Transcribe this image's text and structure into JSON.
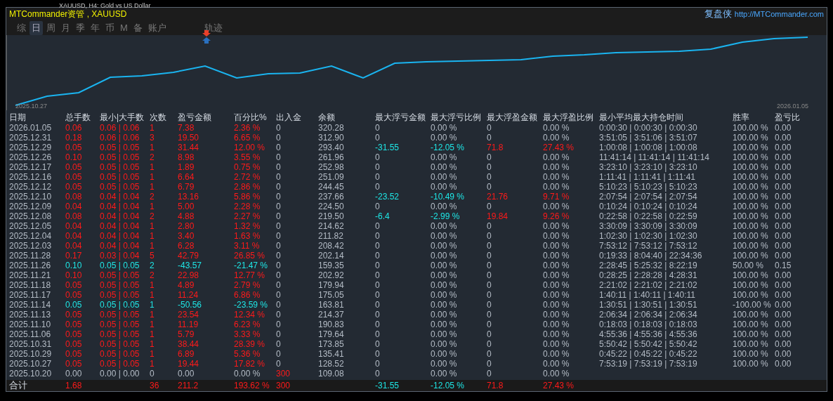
{
  "background_chart": {
    "title": "XAUUSD, H4:  Gold vs US Dollar"
  },
  "window": {
    "title": "MTCommander资管 , XAUUSD",
    "brand": "复盘侠",
    "link": "http://MTCommander.com"
  },
  "tabs": [
    {
      "label": "综",
      "selected": false
    },
    {
      "label": "日",
      "selected": true
    },
    {
      "label": "周",
      "selected": false
    },
    {
      "label": "月",
      "selected": false
    },
    {
      "label": "季",
      "selected": false
    },
    {
      "label": "年",
      "selected": false
    },
    {
      "label": "币",
      "selected": false
    },
    {
      "label": "M",
      "selected": false
    },
    {
      "label": "备",
      "selected": false
    },
    {
      "label": "账户",
      "selected": false
    },
    {
      "label": "轨迹",
      "selected": false
    }
  ],
  "equity_chart": {
    "start_label": "2025.10.27",
    "end_label": "2026.01.05"
  },
  "table": {
    "columns": [
      "日期",
      "总手数",
      "最小|大手数",
      "次数",
      "盈亏金额",
      "百分比%",
      "出入金",
      "余额",
      "最大浮亏金额",
      "最大浮亏比例",
      "最大浮盈金额",
      "最大浮盈比例",
      "最小平均最大持仓时间",
      "胜率",
      "盈亏比"
    ],
    "rows": [
      {
        "kind": "win",
        "floating": false,
        "deposit_flow": false,
        "cells": [
          "2026.01.05",
          "0.06",
          "0.06 | 0.06",
          "1",
          "7.38",
          "2.36 %",
          "0",
          "320.28",
          "0",
          "0.00 %",
          "0",
          "0.00 %",
          "0:00:30 | 0:00:30 | 0:00:30",
          "100.00 %",
          "0.00"
        ]
      },
      {
        "kind": "win",
        "floating": false,
        "deposit_flow": false,
        "cells": [
          "2025.12.31",
          "0.18",
          "0.06 | 0.06",
          "3",
          "19.50",
          "6.65 %",
          "0",
          "312.90",
          "0",
          "0.00 %",
          "0",
          "0.00 %",
          "3:51:05 | 3:51:06 | 3:51:07",
          "100.00 %",
          "0.00"
        ]
      },
      {
        "kind": "win",
        "floating": true,
        "deposit_flow": false,
        "cells": [
          "2025.12.29",
          "0.05",
          "0.05 | 0.05",
          "1",
          "31.44",
          "12.00 %",
          "0",
          "293.40",
          "-31.55",
          "-12.05 %",
          "71.8",
          "27.43 %",
          "1:00:08 | 1:00:08 | 1:00:08",
          "100.00 %",
          "0.00"
        ]
      },
      {
        "kind": "win",
        "floating": false,
        "deposit_flow": false,
        "cells": [
          "2025.12.26",
          "0.10",
          "0.05 | 0.05",
          "2",
          "8.98",
          "3.55 %",
          "0",
          "261.96",
          "0",
          "0.00 %",
          "0",
          "0.00 %",
          "11:41:14 | 11:41:14 | 11:41:14",
          "100.00 %",
          "0.00"
        ]
      },
      {
        "kind": "win",
        "floating": false,
        "deposit_flow": false,
        "cells": [
          "2025.12.17",
          "0.05",
          "0.05 | 0.05",
          "1",
          "1.89",
          "0.75 %",
          "0",
          "252.98",
          "0",
          "0.00 %",
          "0",
          "0.00 %",
          "3:23:10 | 3:23:10 | 3:23:10",
          "100.00 %",
          "0.00"
        ]
      },
      {
        "kind": "win",
        "floating": false,
        "deposit_flow": false,
        "cells": [
          "2025.12.16",
          "0.05",
          "0.05 | 0.05",
          "1",
          "6.64",
          "2.72 %",
          "0",
          "251.09",
          "0",
          "0.00 %",
          "0",
          "0.00 %",
          "1:11:41 | 1:11:41 | 1:11:41",
          "100.00 %",
          "0.00"
        ]
      },
      {
        "kind": "win",
        "floating": false,
        "deposit_flow": false,
        "cells": [
          "2025.12.12",
          "0.05",
          "0.05 | 0.05",
          "1",
          "6.79",
          "2.86 %",
          "0",
          "244.45",
          "0",
          "0.00 %",
          "0",
          "0.00 %",
          "5:10:23 | 5:10:23 | 5:10:23",
          "100.00 %",
          "0.00"
        ]
      },
      {
        "kind": "win",
        "floating": true,
        "deposit_flow": false,
        "cells": [
          "2025.12.10",
          "0.08",
          "0.04 | 0.04",
          "2",
          "13.16",
          "5.86 %",
          "0",
          "237.66",
          "-23.52",
          "-10.49 %",
          "21.76",
          "9.71 %",
          "2:07:54 | 2:07:54 | 2:07:54",
          "100.00 %",
          "0.00"
        ]
      },
      {
        "kind": "win",
        "floating": false,
        "deposit_flow": false,
        "cells": [
          "2025.12.09",
          "0.04",
          "0.04 | 0.04",
          "1",
          "5.00",
          "2.28 %",
          "0",
          "224.50",
          "0",
          "0.00 %",
          "0",
          "0.00 %",
          "0:10:24 | 0:10:24 | 0:10:24",
          "100.00 %",
          "0.00"
        ]
      },
      {
        "kind": "win",
        "floating": true,
        "deposit_flow": false,
        "cells": [
          "2025.12.08",
          "0.08",
          "0.04 | 0.04",
          "2",
          "4.88",
          "2.27 %",
          "0",
          "219.50",
          "-6.4",
          "-2.99 %",
          "19.84",
          "9.26 %",
          "0:22:58 | 0:22:58 | 0:22:59",
          "100.00 %",
          "0.00"
        ]
      },
      {
        "kind": "win",
        "floating": false,
        "deposit_flow": false,
        "cells": [
          "2025.12.05",
          "0.04",
          "0.04 | 0.04",
          "1",
          "2.80",
          "1.32 %",
          "0",
          "214.62",
          "0",
          "0.00 %",
          "0",
          "0.00 %",
          "3:30:09 | 3:30:09 | 3:30:09",
          "100.00 %",
          "0.00"
        ]
      },
      {
        "kind": "win",
        "floating": false,
        "deposit_flow": false,
        "cells": [
          "2025.12.04",
          "0.04",
          "0.04 | 0.04",
          "1",
          "3.40",
          "1.63 %",
          "0",
          "211.82",
          "0",
          "0.00 %",
          "0",
          "0.00 %",
          "1:02:30 | 1:02:30 | 1:02:30",
          "100.00 %",
          "0.00"
        ]
      },
      {
        "kind": "win",
        "floating": false,
        "deposit_flow": false,
        "cells": [
          "2025.12.03",
          "0.04",
          "0.04 | 0.04",
          "1",
          "6.28",
          "3.11 %",
          "0",
          "208.42",
          "0",
          "0.00 %",
          "0",
          "0.00 %",
          "7:53:12 | 7:53:12 | 7:53:12",
          "100.00 %",
          "0.00"
        ]
      },
      {
        "kind": "win",
        "floating": false,
        "deposit_flow": false,
        "cells": [
          "2025.11.28",
          "0.17",
          "0.03 | 0.04",
          "5",
          "42.79",
          "26.85 %",
          "0",
          "202.14",
          "0",
          "0.00 %",
          "0",
          "0.00 %",
          "0:19:33 | 8:04:40 | 22:34:36",
          "100.00 %",
          "0.00"
        ]
      },
      {
        "kind": "loss",
        "floating": false,
        "deposit_flow": false,
        "cells": [
          "2025.11.26",
          "0.10",
          "0.05 | 0.05",
          "2",
          "-43.57",
          "-21.47 %",
          "0",
          "159.35",
          "0",
          "0.00 %",
          "0",
          "0.00 %",
          "2:28:45 | 5:25:32 | 8:22:19",
          "50.00 %",
          "0.15"
        ]
      },
      {
        "kind": "win",
        "floating": false,
        "deposit_flow": false,
        "cells": [
          "2025.11.21",
          "0.10",
          "0.05 | 0.05",
          "2",
          "22.98",
          "12.77 %",
          "0",
          "202.92",
          "0",
          "0.00 %",
          "0",
          "0.00 %",
          "0:28:25 | 2:28:28 | 4:28:31",
          "100.00 %",
          "0.00"
        ]
      },
      {
        "kind": "win",
        "floating": false,
        "deposit_flow": false,
        "cells": [
          "2025.11.18",
          "0.05",
          "0.05 | 0.05",
          "1",
          "4.89",
          "2.79 %",
          "0",
          "179.94",
          "0",
          "0.00 %",
          "0",
          "0.00 %",
          "2:21:02 | 2:21:02 | 2:21:02",
          "100.00 %",
          "0.00"
        ]
      },
      {
        "kind": "win",
        "floating": false,
        "deposit_flow": false,
        "cells": [
          "2025.11.17",
          "0.05",
          "0.05 | 0.05",
          "1",
          "11.24",
          "6.86 %",
          "0",
          "175.05",
          "0",
          "0.00 %",
          "0",
          "0.00 %",
          "1:40:11 | 1:40:11 | 1:40:11",
          "100.00 %",
          "0.00"
        ]
      },
      {
        "kind": "loss",
        "floating": false,
        "deposit_flow": false,
        "cells": [
          "2025.11.14",
          "0.05",
          "0.05 | 0.05",
          "1",
          "-50.56",
          "-23.59 %",
          "0",
          "163.81",
          "0",
          "0.00 %",
          "0",
          "0.00 %",
          "1:30:51 | 1:30:51 | 1:30:51",
          "-100.00 %",
          "0.00"
        ]
      },
      {
        "kind": "win",
        "floating": false,
        "deposit_flow": false,
        "cells": [
          "2025.11.13",
          "0.05",
          "0.05 | 0.05",
          "1",
          "23.54",
          "12.34 %",
          "0",
          "214.37",
          "0",
          "0.00 %",
          "0",
          "0.00 %",
          "2:06:34 | 2:06:34 | 2:06:34",
          "100.00 %",
          "0.00"
        ]
      },
      {
        "kind": "win",
        "floating": false,
        "deposit_flow": false,
        "cells": [
          "2025.11.10",
          "0.05",
          "0.05 | 0.05",
          "1",
          "11.19",
          "6.23 %",
          "0",
          "190.83",
          "0",
          "0.00 %",
          "0",
          "0.00 %",
          "0:18:03 | 0:18:03 | 0:18:03",
          "100.00 %",
          "0.00"
        ]
      },
      {
        "kind": "win",
        "floating": false,
        "deposit_flow": false,
        "cells": [
          "2025.11.06",
          "0.05",
          "0.05 | 0.05",
          "1",
          "5.79",
          "3.33 %",
          "0",
          "179.64",
          "0",
          "0.00 %",
          "0",
          "0.00 %",
          "4:55:36 | 4:55:36 | 4:55:36",
          "100.00 %",
          "0.00"
        ]
      },
      {
        "kind": "win",
        "floating": false,
        "deposit_flow": false,
        "cells": [
          "2025.10.31",
          "0.05",
          "0.05 | 0.05",
          "1",
          "38.44",
          "28.39 %",
          "0",
          "173.85",
          "0",
          "0.00 %",
          "0",
          "0.00 %",
          "5:50:42 | 5:50:42 | 5:50:42",
          "100.00 %",
          "0.00"
        ]
      },
      {
        "kind": "win",
        "floating": false,
        "deposit_flow": false,
        "cells": [
          "2025.10.29",
          "0.05",
          "0.05 | 0.05",
          "1",
          "6.89",
          "5.36 %",
          "0",
          "135.41",
          "0",
          "0.00 %",
          "0",
          "0.00 %",
          "0:45:22 | 0:45:22 | 0:45:22",
          "100.00 %",
          "0.00"
        ]
      },
      {
        "kind": "win",
        "floating": false,
        "deposit_flow": false,
        "cells": [
          "2025.10.27",
          "0.05",
          "0.05 | 0.05",
          "1",
          "19.44",
          "17.82 %",
          "0",
          "128.52",
          "0",
          "0.00 %",
          "0",
          "0.00 %",
          "7:53:19 | 7:53:19 | 7:53:19",
          "100.00 %",
          "0.00"
        ]
      },
      {
        "kind": "flat",
        "floating": false,
        "deposit_flow": true,
        "cells": [
          "2025.10.20",
          "0.00",
          "0.00 | 0.00",
          "0",
          "0.00",
          "0.00 %",
          "300",
          "109.08",
          "0",
          "0.00 %",
          "0",
          "0.00 %"
        ]
      }
    ],
    "totals": {
      "label": "合计",
      "lots": "1.68",
      "count": "36",
      "pnl": "211.2",
      "pct": "193.62 %",
      "deposit": "300",
      "max_float_loss": "-31.55",
      "max_float_loss_pct": "-12.05 %",
      "max_float_profit": "71.8",
      "max_float_profit_pct": "27.43 %"
    }
  }
}
